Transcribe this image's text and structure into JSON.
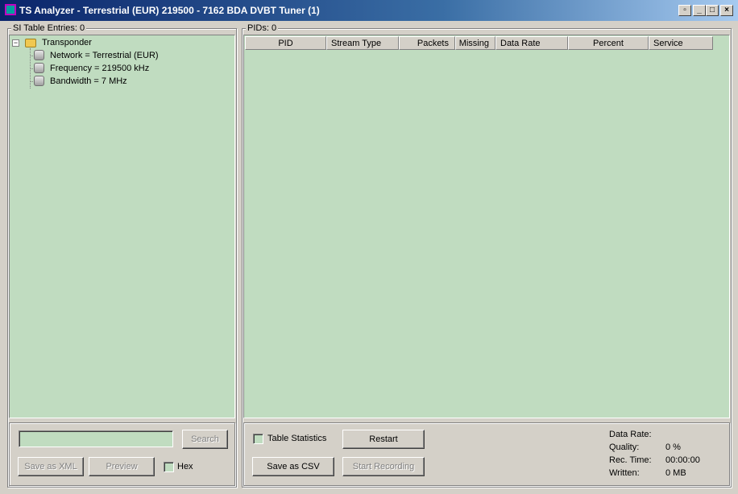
{
  "window": {
    "title": "TS Analyzer - Terrestrial (EUR) 219500 - 7162 BDA DVBT Tuner (1)",
    "buttons": {
      "restore": "▫",
      "minimize": "_",
      "maximize": "□",
      "close": "×"
    }
  },
  "si_panel": {
    "legend": "SI Table Entries: 0",
    "tree": {
      "root": "Transponder",
      "expander": "−",
      "children": [
        "Network = Terrestrial (EUR)",
        "Frequency = 219500 kHz",
        "Bandwidth = 7 MHz"
      ]
    }
  },
  "pid_panel": {
    "legend": "PIDs: 0",
    "columns": [
      "PID",
      "Stream Type",
      "Packets",
      "Missing",
      "Data Rate",
      "Percent",
      "Service"
    ]
  },
  "search": {
    "value": "",
    "button": "Search"
  },
  "left_actions": {
    "save_xml": "Save as XML",
    "preview": "Preview",
    "hex_label": "Hex"
  },
  "right_actions": {
    "table_statistics_label": "Table Statistics",
    "restart": "Restart",
    "save_csv": "Save as CSV",
    "start_recording": "Start Recording"
  },
  "stats": {
    "data_rate_label": "Data Rate:",
    "data_rate_value": "",
    "quality_label": "Quality:",
    "quality_value": "0 %",
    "rec_time_label": "Rec. Time:",
    "rec_time_value": "00:00:00",
    "written_label": "Written:",
    "written_value": "0 MB"
  },
  "colors": {
    "list_background": "#c0dcc0",
    "window_face": "#d4d0c8",
    "title_start": "#0a246a",
    "title_end": "#a6caf0"
  }
}
